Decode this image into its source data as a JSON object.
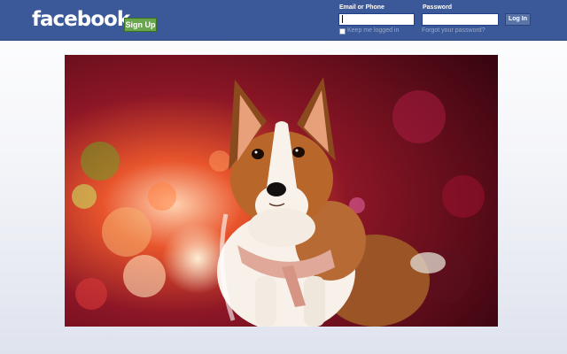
{
  "header": {
    "logo_text": "facebook",
    "signup_label": "Sign Up",
    "email_label": "Email or Phone",
    "password_label": "Password",
    "email_value": "",
    "password_value": "",
    "login_label": "Log In",
    "keep_logged_in_label": "Keep me logged in",
    "keep_logged_in_checked": false,
    "forgot_password_label": "Forgot your password?"
  },
  "main": {
    "photo_subject": "corgi-dog"
  },
  "colors": {
    "header_bg": "#3b5998",
    "signup_bg": "#69a74e",
    "link_color": "#98a9ca"
  }
}
